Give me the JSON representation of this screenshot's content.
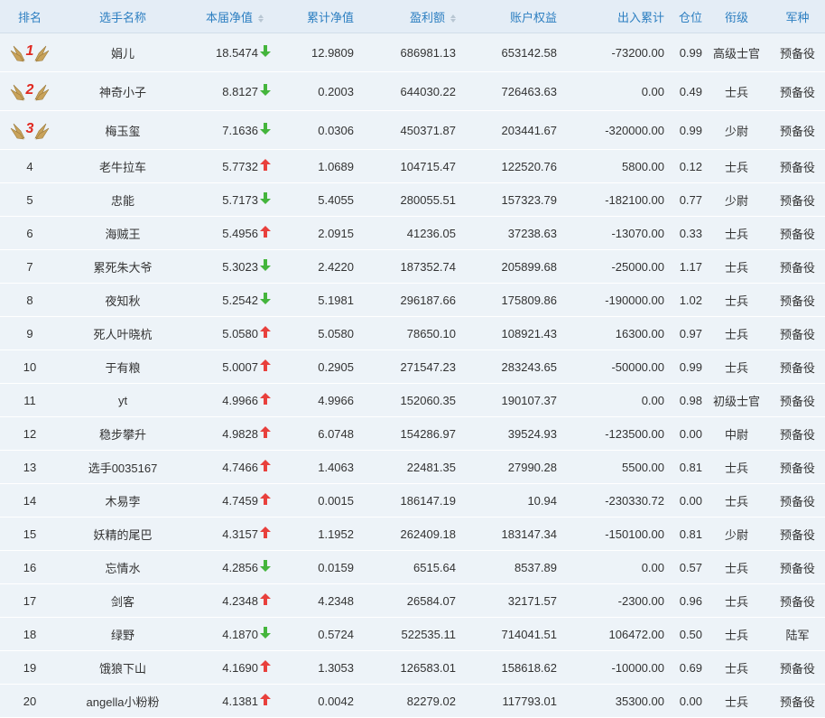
{
  "headers": {
    "rank": "排名",
    "name": "选手名称",
    "nav": "本届净值",
    "cum_nav": "累计净值",
    "profit": "盈利额",
    "equity": "账户权益",
    "flow": "出入累计",
    "position": "仓位",
    "title": "衔级",
    "arm": "军种"
  },
  "colors": {
    "up": "#e8403c",
    "down": "#44b53c",
    "header_text": "#2d7fc1",
    "medal": "#e02a22"
  },
  "rows": [
    {
      "rank": "1",
      "medal": true,
      "name": "娟儿",
      "nav": "18.5474",
      "trend": "down",
      "cum": "12.9809",
      "profit": "686981.13",
      "equity": "653142.58",
      "flow": "-73200.00",
      "pos": "0.99",
      "title": "高级士官",
      "arm": "预备役"
    },
    {
      "rank": "2",
      "medal": true,
      "name": "神奇小子",
      "nav": "8.8127",
      "trend": "down",
      "cum": "0.2003",
      "profit": "644030.22",
      "equity": "726463.63",
      "flow": "0.00",
      "pos": "0.49",
      "title": "士兵",
      "arm": "预备役"
    },
    {
      "rank": "3",
      "medal": true,
      "name": "梅玉玺",
      "nav": "7.1636",
      "trend": "down",
      "cum": "0.0306",
      "profit": "450371.87",
      "equity": "203441.67",
      "flow": "-320000.00",
      "pos": "0.99",
      "title": "少尉",
      "arm": "预备役"
    },
    {
      "rank": "4",
      "name": "老牛拉车",
      "nav": "5.7732",
      "trend": "up",
      "cum": "1.0689",
      "profit": "104715.47",
      "equity": "122520.76",
      "flow": "5800.00",
      "pos": "0.12",
      "title": "士兵",
      "arm": "预备役"
    },
    {
      "rank": "5",
      "name": "忠能",
      "nav": "5.7173",
      "trend": "down",
      "cum": "5.4055",
      "profit": "280055.51",
      "equity": "157323.79",
      "flow": "-182100.00",
      "pos": "0.77",
      "title": "少尉",
      "arm": "预备役"
    },
    {
      "rank": "6",
      "name": "海贼王",
      "nav": "5.4956",
      "trend": "up",
      "cum": "2.0915",
      "profit": "41236.05",
      "equity": "37238.63",
      "flow": "-13070.00",
      "pos": "0.33",
      "title": "士兵",
      "arm": "预备役"
    },
    {
      "rank": "7",
      "name": "累死朱大爷",
      "nav": "5.3023",
      "trend": "down",
      "cum": "2.4220",
      "profit": "187352.74",
      "equity": "205899.68",
      "flow": "-25000.00",
      "pos": "1.17",
      "title": "士兵",
      "arm": "预备役"
    },
    {
      "rank": "8",
      "name": "夜知秋",
      "nav": "5.2542",
      "trend": "down",
      "cum": "5.1981",
      "profit": "296187.66",
      "equity": "175809.86",
      "flow": "-190000.00",
      "pos": "1.02",
      "title": "士兵",
      "arm": "预备役"
    },
    {
      "rank": "9",
      "name": "死人叶晓杭",
      "nav": "5.0580",
      "trend": "up",
      "cum": "5.0580",
      "profit": "78650.10",
      "equity": "108921.43",
      "flow": "16300.00",
      "pos": "0.97",
      "title": "士兵",
      "arm": "预备役"
    },
    {
      "rank": "10",
      "name": "于有粮",
      "nav": "5.0007",
      "trend": "up",
      "cum": "0.2905",
      "profit": "271547.23",
      "equity": "283243.65",
      "flow": "-50000.00",
      "pos": "0.99",
      "title": "士兵",
      "arm": "预备役"
    },
    {
      "rank": "11",
      "name": "yt",
      "nav": "4.9966",
      "trend": "up",
      "cum": "4.9966",
      "profit": "152060.35",
      "equity": "190107.37",
      "flow": "0.00",
      "pos": "0.98",
      "title": "初级士官",
      "arm": "预备役"
    },
    {
      "rank": "12",
      "name": "稳步攀升",
      "nav": "4.9828",
      "trend": "up",
      "cum": "6.0748",
      "profit": "154286.97",
      "equity": "39524.93",
      "flow": "-123500.00",
      "pos": "0.00",
      "title": "中尉",
      "arm": "预备役"
    },
    {
      "rank": "13",
      "name": "选手0035167",
      "nav": "4.7466",
      "trend": "up",
      "cum": "1.4063",
      "profit": "22481.35",
      "equity": "27990.28",
      "flow": "5500.00",
      "pos": "0.81",
      "title": "士兵",
      "arm": "预备役"
    },
    {
      "rank": "14",
      "name": "木易孛",
      "nav": "4.7459",
      "trend": "up",
      "cum": "0.0015",
      "profit": "186147.19",
      "equity": "10.94",
      "flow": "-230330.72",
      "pos": "0.00",
      "title": "士兵",
      "arm": "预备役"
    },
    {
      "rank": "15",
      "name": "妖精的尾巴",
      "nav": "4.3157",
      "trend": "up",
      "cum": "1.1952",
      "profit": "262409.18",
      "equity": "183147.34",
      "flow": "-150100.00",
      "pos": "0.81",
      "title": "少尉",
      "arm": "预备役"
    },
    {
      "rank": "16",
      "name": "忘情水",
      "nav": "4.2856",
      "trend": "down",
      "cum": "0.0159",
      "profit": "6515.64",
      "equity": "8537.89",
      "flow": "0.00",
      "pos": "0.57",
      "title": "士兵",
      "arm": "预备役"
    },
    {
      "rank": "17",
      "name": "剑客",
      "nav": "4.2348",
      "trend": "up",
      "cum": "4.2348",
      "profit": "26584.07",
      "equity": "32171.57",
      "flow": "-2300.00",
      "pos": "0.96",
      "title": "士兵",
      "arm": "预备役"
    },
    {
      "rank": "18",
      "name": "绿野",
      "nav": "4.1870",
      "trend": "down",
      "cum": "0.5724",
      "profit": "522535.11",
      "equity": "714041.51",
      "flow": "106472.00",
      "pos": "0.50",
      "title": "士兵",
      "arm": "陆军"
    },
    {
      "rank": "19",
      "name": "饿狼下山",
      "nav": "4.1690",
      "trend": "up",
      "cum": "1.3053",
      "profit": "126583.01",
      "equity": "158618.62",
      "flow": "-10000.00",
      "pos": "0.69",
      "title": "士兵",
      "arm": "预备役"
    },
    {
      "rank": "20",
      "name": "angella小粉粉",
      "nav": "4.1381",
      "trend": "up",
      "cum": "0.0042",
      "profit": "82279.02",
      "equity": "117793.01",
      "flow": "35300.00",
      "pos": "0.00",
      "title": "士兵",
      "arm": "预备役"
    }
  ]
}
